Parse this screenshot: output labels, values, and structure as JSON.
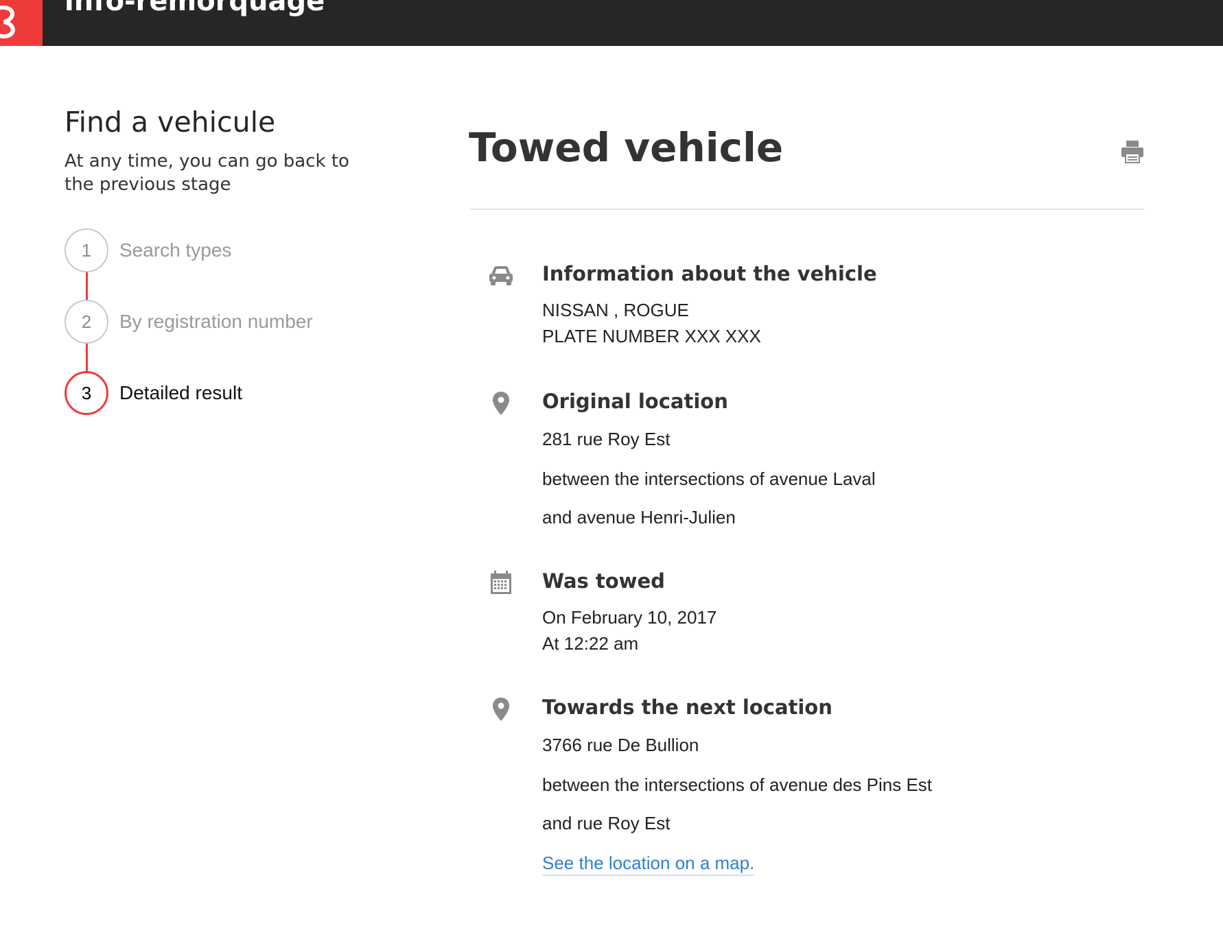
{
  "app": {
    "title": "info-remorquage"
  },
  "sidebar": {
    "title": "Find a vehicule",
    "subtitle": "At any time, you can go back to the previous stage",
    "steps": [
      {
        "number": "1",
        "label": "Search types"
      },
      {
        "number": "2",
        "label": "By registration number"
      },
      {
        "number": "3",
        "label": "Detailed result"
      }
    ],
    "active_step": 3
  },
  "main": {
    "title": "Towed vehicle",
    "print_icon": "printer-icon",
    "vehicle": {
      "heading": "Information about the vehicle",
      "icon": "car-icon",
      "make_model": "NISSAN , ROGUE",
      "plate": "PLATE NUMBER XXX XXX"
    },
    "original_location": {
      "heading": "Original location",
      "icon": "map-pin-icon",
      "address": "281 rue Roy Est",
      "between": "between the intersections of avenue Laval",
      "and": "and avenue Henri-Julien"
    },
    "towed": {
      "heading": "Was towed",
      "icon": "calendar-icon",
      "date": "On February 10, 2017",
      "time": "At 12:22 am"
    },
    "next_location": {
      "heading": "Towards the next location",
      "icon": "map-pin-icon",
      "address": "3766 rue De Bullion",
      "between": "between the intersections of avenue des Pins Est",
      "and": "and rue Roy Est",
      "map_link": "See the location on a map."
    }
  },
  "colors": {
    "brand_red": "#ef3b39",
    "header_bg": "#262626",
    "link_blue": "#2f7fd1",
    "icon_gray": "#8a8a8a"
  }
}
